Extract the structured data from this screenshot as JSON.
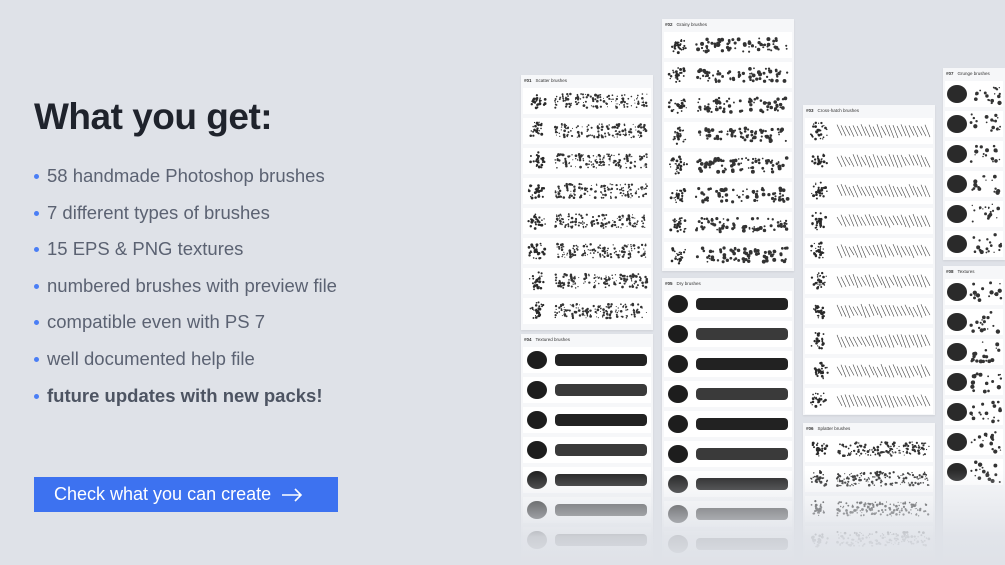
{
  "headline": "What you get:",
  "features": [
    {
      "text": "58 handmade Photoshop brushes",
      "bold": false
    },
    {
      "text": "7 different types of brushes",
      "bold": false
    },
    {
      "text": "15 EPS & PNG textures",
      "bold": false
    },
    {
      "text": "numbered brushes with preview file",
      "bold": false
    },
    {
      "text": "compatible even with PS 7",
      "bold": false
    },
    {
      "text": "well documented help file",
      "bold": false
    },
    {
      "text": "future updates with new packs!",
      "bold": true
    }
  ],
  "cta": {
    "label": "Check what you can create",
    "icon": "arrow-right-icon"
  },
  "colors": {
    "accent": "#3d72f0",
    "background": "#dfe2e8",
    "bullet": "#4a7ef5"
  },
  "sheets": [
    {
      "id": "sheet-1",
      "number": "#01",
      "title": "Scatter brushes",
      "style": "stipple"
    },
    {
      "id": "sheet-2",
      "number": "#02",
      "title": "Grainy brushes",
      "style": "dots"
    },
    {
      "id": "sheet-3",
      "number": "#03",
      "title": "Cross-hatch brushes",
      "style": "hatch"
    },
    {
      "id": "sheet-4",
      "number": "#04",
      "title": "Textured brushes",
      "style": "rough"
    },
    {
      "id": "sheet-5",
      "number": "#05",
      "title": "Dry brushes",
      "style": "rough"
    },
    {
      "id": "sheet-6",
      "number": "#06",
      "title": "Splatter brushes",
      "style": "splatter"
    },
    {
      "id": "sheet-7",
      "number": "#07",
      "title": "Grunge brushes",
      "style": "texture"
    },
    {
      "id": "sheet-8",
      "number": "#08",
      "title": "Textures",
      "style": "texture"
    }
  ]
}
